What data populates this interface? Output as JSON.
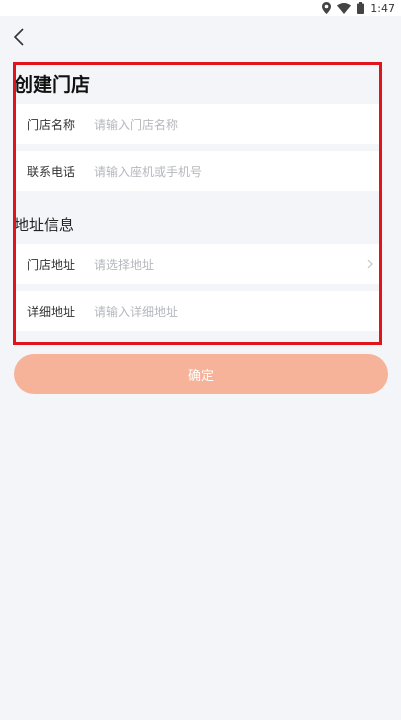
{
  "status_bar": {
    "time": "1:47",
    "icons": [
      "location-icon",
      "wifi-icon",
      "battery-icon"
    ]
  },
  "header": {
    "back_icon": "chevron-left-icon",
    "title": "创建门店"
  },
  "store_form": {
    "store_name": {
      "label": "门店名称",
      "placeholder": "请输入门店名称"
    },
    "phone": {
      "label": "联系电话",
      "placeholder": "请输入座机或手机号"
    }
  },
  "address_section": {
    "title": "地址信息",
    "store_address": {
      "label": "门店地址",
      "placeholder": "请选择地址",
      "icon": "chevron-right-icon"
    },
    "detail_address": {
      "label": "详细地址",
      "placeholder": "请输入详细地址"
    }
  },
  "confirm_button": {
    "label": "确定"
  },
  "colors": {
    "page_background": "#f4f5f9",
    "row_background": "#ffffff",
    "highlight_border": "#e0141b",
    "button_background": "#f6b39a",
    "placeholder_text": "#b5b7bd"
  }
}
